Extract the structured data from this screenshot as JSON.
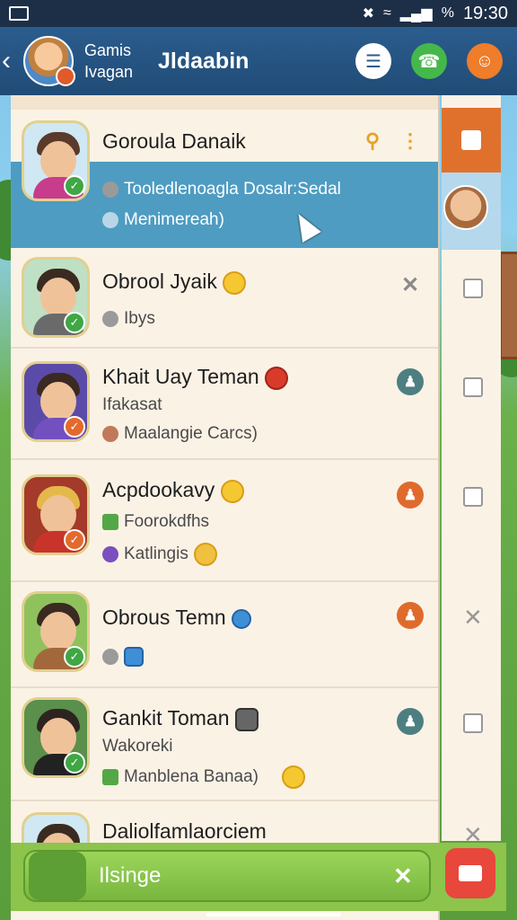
{
  "status_bar": {
    "time": "19:30",
    "icons": [
      "screenshot-icon",
      "mute-icon",
      "wifi-icon",
      "signal-icon",
      "battery-percent-icon"
    ],
    "battery_text": "%"
  },
  "header": {
    "back_icon": "back-arrow-icon",
    "subtitle_line1": "Gamis",
    "subtitle_line2": "Ivagan",
    "title": "Jldaabin",
    "buttons": [
      "layers-icon",
      "phone-icon",
      "smiley-icon"
    ]
  },
  "contacts": [
    {
      "name": "Goroula Danaik",
      "line1": "Tooledlenoagla Dosalr:Sedal",
      "line2": "Menimereah)",
      "action": "search-icon",
      "selected": true
    },
    {
      "name": "Obrool Jyaik",
      "line1": "Ibys",
      "line2": "",
      "action": "close-icon",
      "selected": false
    },
    {
      "name": "Khait Uay Teman",
      "line1": "Ifakasat",
      "line2": "Maalangie Carcs)",
      "action": "person-icon",
      "selected": false
    },
    {
      "name": "Acpdookavy",
      "line1": "Foorokdfhs",
      "line2": "Katlingis",
      "action": "person-icon",
      "selected": false
    },
    {
      "name": "Obrous Temn",
      "line1": "",
      "line2": "",
      "action": "person-icon",
      "selected": false
    },
    {
      "name": "Gankit Toman",
      "line1": "Wakoreki",
      "line2": "Manblena Banaa)",
      "action": "person-icon",
      "selected": false
    },
    {
      "name": "Daliolfamlaorciem",
      "line1": "",
      "line2": "",
      "action": "",
      "selected": false
    }
  ],
  "bottom_bar": {
    "input_text": "Ilsinge",
    "close_icon": "close-icon",
    "action_icon": "castle-icon"
  },
  "colors": {
    "header": "#2b5d8e",
    "selected_row": "#4e9cc2",
    "panel": "#fbf2e6",
    "bottom_bar": "#8cc44c",
    "accent_orange": "#e0712d"
  }
}
